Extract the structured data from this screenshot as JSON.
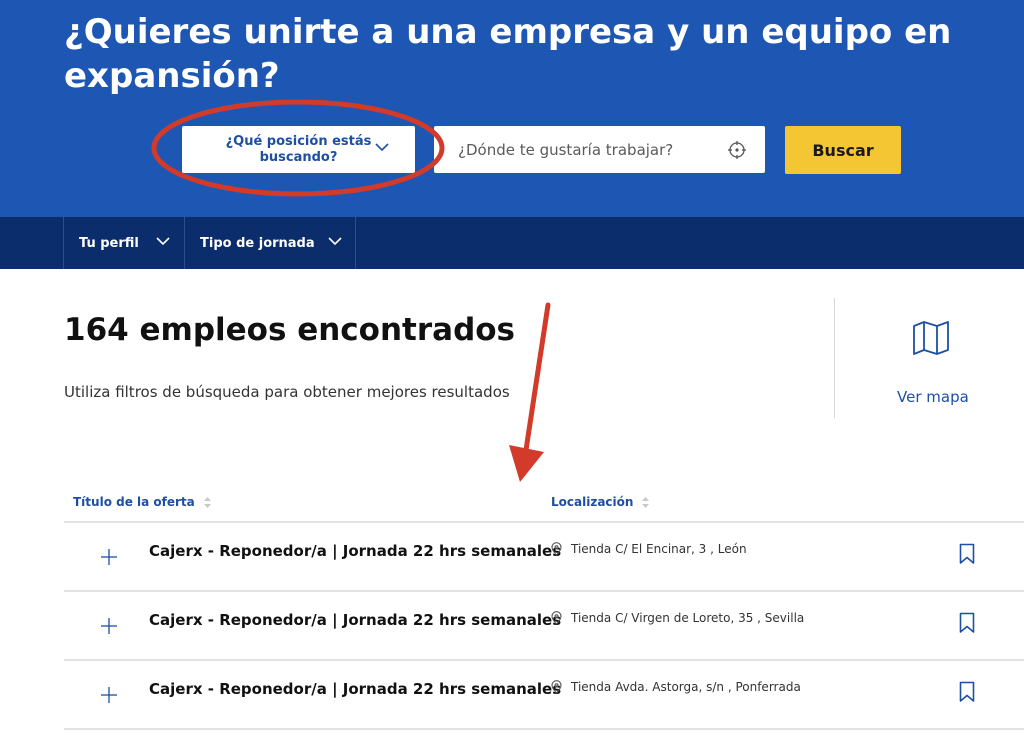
{
  "hero": {
    "title": "¿Quieres unirte a una empresa y un equipo en expansión?",
    "position_select_label": "¿Qué posición estás buscando?",
    "location_placeholder": "¿Dónde te gustaría trabajar?",
    "search_button": "Buscar"
  },
  "filters": [
    {
      "label": "Tu perfil"
    },
    {
      "label": "Tipo de jornada"
    }
  ],
  "results": {
    "title": "164 empleos encontrados",
    "subtitle": "Utiliza filtros de búsqueda para obtener mejores resultados",
    "map_link": "Ver mapa"
  },
  "table": {
    "col_title": "Título de la oferta",
    "col_location": "Localización",
    "rows": [
      {
        "title": "Cajerx - Reponedor/a | Jornada 22 hrs semanales",
        "location": "Tienda C/ El Encinar, 3 , León"
      },
      {
        "title": "Cajerx - Reponedor/a | Jornada 22 hrs semanales",
        "location": "Tienda C/ Virgen de Loreto, 35 , Sevilla"
      },
      {
        "title": "Cajerx - Reponedor/a | Jornada 22 hrs semanales",
        "location": "Tienda Avda. Astorga, s/n , Ponferrada"
      }
    ]
  },
  "colors": {
    "hero_bg": "#1e56b3",
    "filterbar_bg": "#0b2d6c",
    "accent_yellow": "#f5c634",
    "link_blue": "#1e4fa3",
    "annotation_red": "#d23a2a"
  },
  "icons": [
    "chevron-down-icon",
    "locate-icon",
    "map-icon",
    "sort-icon",
    "plus-icon",
    "pin-icon",
    "bookmark-icon"
  ]
}
